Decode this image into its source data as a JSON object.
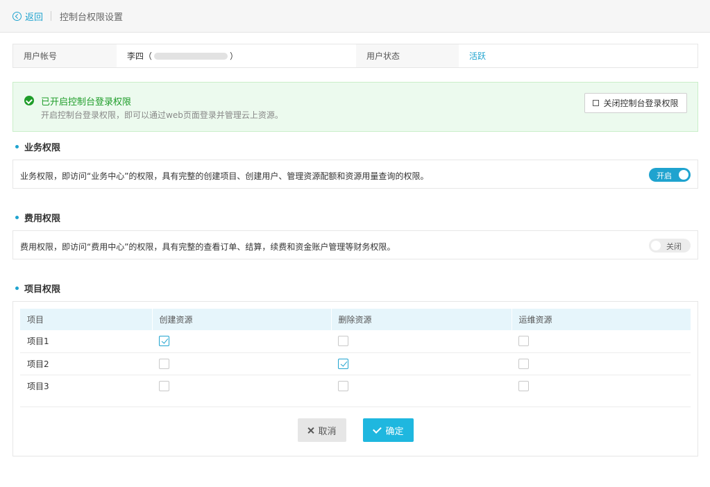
{
  "header": {
    "back_label": "返回",
    "title": "控制台权限设置"
  },
  "user_info": {
    "account_label": "用户帐号",
    "account_name": "李四（",
    "account_suffix": "）",
    "status_label": "用户状态",
    "status_value": "活跃",
    "status_color": "#1fa3cf"
  },
  "console_access": {
    "title": "已开启控制台登录权限",
    "description": "开启控制台登录权限，即可以通过web页面登录并管理云上资源。",
    "close_button_label": "关闭控制台登录权限",
    "title_color": "#1f9d2a"
  },
  "business_permission": {
    "section_title": "业务权限",
    "description": "业务权限，即访问“业务中心”的权限，具有完整的创建项目、创建用户、管理资源配额和资源用量查询的权限。",
    "switch_label": "开启",
    "enabled": true
  },
  "billing_permission": {
    "section_title": "费用权限",
    "description": "费用权限，即访问“费用中心”的权限，具有完整的查看订单、结算，续费和资金账户管理等财务权限。",
    "switch_label": "关闭",
    "enabled": false
  },
  "project_permission": {
    "section_title": "项目权限",
    "columns": [
      "项目",
      "创建资源",
      "删除资源",
      "运维资源"
    ],
    "rows": [
      {
        "name": "项目1",
        "create": true,
        "delete": false,
        "ops": false
      },
      {
        "name": "项目2",
        "create": false,
        "delete": true,
        "ops": false
      },
      {
        "name": "项目3",
        "create": false,
        "delete": false,
        "ops": false
      }
    ]
  },
  "actions": {
    "cancel_label": "取消",
    "confirm_label": "确定",
    "accent_color": "#1fb7df"
  }
}
